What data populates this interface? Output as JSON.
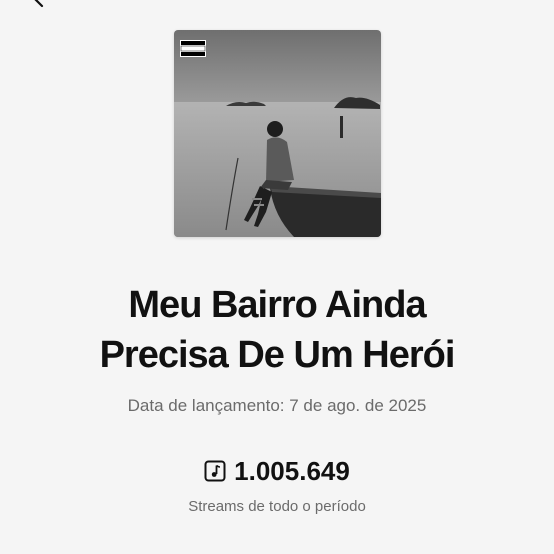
{
  "header": {
    "back_icon": "chevron-left-icon"
  },
  "album": {
    "cover_badge_lines": [
      "PARENTAL",
      "ADVISORY",
      "EXPLICIT CONTENT"
    ],
    "title_line_1": "Meu Bairro Ainda",
    "title_line_2": "Precisa De Um Herói",
    "release_text": "Data de lançamento: 7 de ago. de 2025"
  },
  "stats": {
    "icon": "music-note-icon",
    "streams_value": "1.005.649",
    "streams_label": "Streams de todo o período"
  }
}
